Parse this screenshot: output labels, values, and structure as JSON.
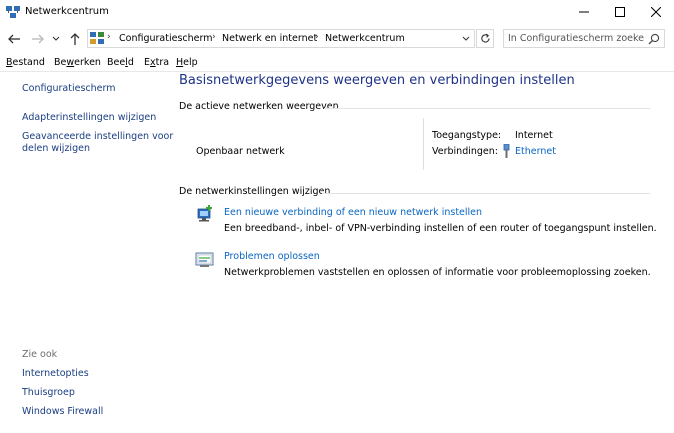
{
  "window": {
    "title": "Netwerkcentrum",
    "controls": {
      "minimize": "—",
      "maximize": "☐",
      "close": "✕"
    }
  },
  "nav": {
    "back": "←",
    "forward": "→",
    "recent": "⌄",
    "up": "↑",
    "breadcrumbs": [
      "Configuratiescherm",
      "Netwerk en internet",
      "Netwerkcentrum"
    ],
    "separator": "›",
    "search_placeholder": "In Configuratiescherm zoeken"
  },
  "menu": {
    "items": [
      {
        "pre": "",
        "u": "B",
        "post": "estand"
      },
      {
        "pre": "Be",
        "u": "w",
        "post": "erken"
      },
      {
        "pre": "Bee",
        "u": "l",
        "post": "d"
      },
      {
        "pre": "E",
        "u": "x",
        "post": "tra"
      },
      {
        "pre": "",
        "u": "H",
        "post": "elp"
      }
    ]
  },
  "sidebar": {
    "home": "Configuratiescherm",
    "links": [
      "Adapterinstellingen wijzigen",
      "Geavanceerde instellingen voor",
      "delen wijzigen"
    ],
    "see_also_label": "Zie ook",
    "see_also": [
      "Internetopties",
      "Thuisgroep",
      "Windows Firewall"
    ]
  },
  "main": {
    "title": "Basisnetwerkgegevens weergeven en verbindingen instellen",
    "active_section": "De actieve netwerken weergeven",
    "network_name": "Openbaar netwerk",
    "access_type_label": "Toegangstype:",
    "access_type_value": "Internet",
    "connections_label": "Verbindingen:",
    "connections_value": "Ethernet",
    "settings_section": "De netwerkinstellingen wijzigen",
    "tasks": [
      {
        "link": "Een nieuwe verbinding of een nieuw netwerk instellen",
        "desc": "Een breedband-, inbel- of VPN-verbinding instellen of een router of toegangspunt instellen."
      },
      {
        "link": "Problemen oplossen",
        "desc": "Netwerkproblemen vaststellen en oplossen of informatie voor probleemoplossing zoeken."
      }
    ]
  },
  "colors": {
    "link": "#0a66c2",
    "heading": "#1e3287",
    "sidebar_link": "#1a3e82"
  }
}
